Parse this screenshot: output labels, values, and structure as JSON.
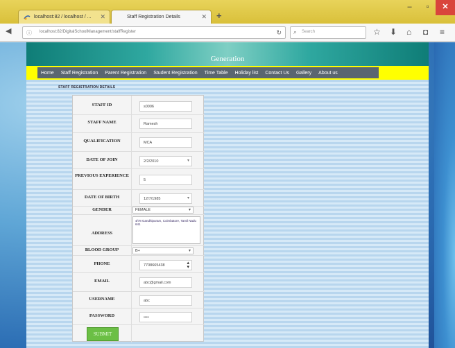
{
  "browser": {
    "tabs": [
      {
        "title": "localhost:82 / localhost / ..."
      },
      {
        "title": "Staff Registration Details"
      }
    ],
    "url": "localhost:82/DigitalSchoolManagement/staffRegister",
    "search_placeholder": "Search"
  },
  "site": {
    "title": "Generation",
    "menu": [
      "Home",
      "Staff Registration",
      "Parent Registration",
      "Student Registration",
      "Time Table",
      "Holiday list",
      "Contact Us",
      "Gallery",
      "About us"
    ],
    "section_label": "STAFF REGISTRATION DETAILS"
  },
  "form": {
    "labels": {
      "staff_id": "STAFF ID",
      "staff_name": "STAFF NAME",
      "qualification": "QUALIFICATION",
      "date_of_join": "DATE OF JOIN",
      "previous_experience": "PREVIOUS EXPERIENCE",
      "date_of_birth": "DATE OF BIRTH",
      "gender": "GENDER",
      "address": "ADDRESS",
      "blood_group": "BLOOD GROUP",
      "phone": "PHONE",
      "email": "EMAIL",
      "username": "USERNAME",
      "password": "PASSWORD"
    },
    "values": {
      "staff_id": "s0006",
      "staff_name": "Ramesh",
      "qualification": "MCA",
      "date_of_join": "2/2/2010",
      "previous_experience": "5",
      "date_of_birth": "12/7/1985",
      "gender": "FEMALE",
      "address": "4/78 Gandhipuram, Coimbatore, Tamil Nadu 641",
      "blood_group": "B+",
      "phone": "7708665438",
      "email": "abc@gmail.com",
      "username": "abc",
      "password": "••••"
    },
    "submit_label": "SUBMIT"
  }
}
